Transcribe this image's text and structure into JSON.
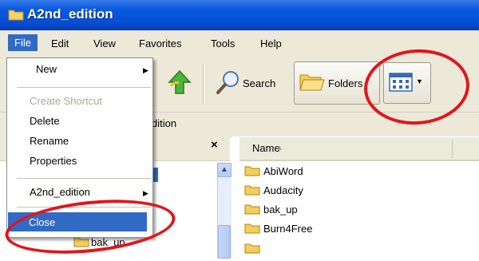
{
  "window": {
    "title": "A2nd_edition"
  },
  "menubar": {
    "items": [
      "File",
      "Edit",
      "View",
      "Favorites",
      "Tools",
      "Help"
    ]
  },
  "toolbar": {
    "search_label": "Search",
    "folders_label": "Folders"
  },
  "address": {
    "text": "dition"
  },
  "file_menu": {
    "new": "New",
    "create_shortcut": "Create Shortcut",
    "delete": "Delete",
    "rename": "Rename",
    "properties": "Properties",
    "recent_folder": "A2nd_edition",
    "close": "Close"
  },
  "left_pane": {
    "close_glyph": "×",
    "partial_item": "bak_up"
  },
  "file_list": {
    "column_name": "Name",
    "sort_glyph": "▲",
    "folders": [
      "AbiWord",
      "Audacity",
      "bak_up",
      "Burn4Free"
    ]
  },
  "colors": {
    "highlight": "#316ac5",
    "annotation_ring": "#e0161c",
    "titlebar": "#0450d6"
  }
}
